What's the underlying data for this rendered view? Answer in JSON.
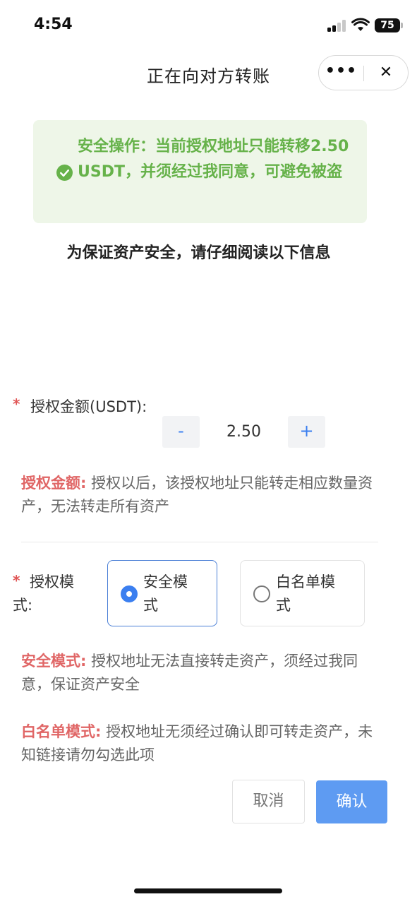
{
  "status_bar": {
    "time": "4:54",
    "battery": "75"
  },
  "header": {
    "title": "正在向对方转账",
    "more_label": "•••",
    "close_label": "✕"
  },
  "notice": {
    "text": "安全操作：当前授权地址只能转移2.50 USDT，并须经过我同意，可避免被盗",
    "icon": "check-circle-icon",
    "color": "#66b24a"
  },
  "subtitle": "为保证资产安全，请仔细阅读以下信息",
  "amount": {
    "required_mark": "*",
    "label": "授权金额(USDT):",
    "minus_label": "-",
    "value": "2.50",
    "plus_label": "+",
    "desc_title": "授权金额:",
    "desc_text": " 授权以后，该授权地址只能转走相应数量资产，无法转走所有资产"
  },
  "mode": {
    "required_mark": "*",
    "label": "授权模式:",
    "options": [
      {
        "label": "安全模式",
        "selected": true
      },
      {
        "label": "白名单模式",
        "selected": false
      }
    ],
    "safe_desc_title": "安全模式:",
    "safe_desc_text": " 授权地址无法直接转走资产，须经过我同意，保证资产安全",
    "white_desc_title": "白名单模式:",
    "white_desc_text": " 授权地址无须经过确认即可转走资产，未知链接请勿勾选此项"
  },
  "actions": {
    "cancel_label": "取消",
    "confirm_label": "确认"
  },
  "colors": {
    "accent": "#3b7ff0",
    "confirm_bg": "#5e9bf2",
    "highlight": "#e06666",
    "required": "#e05555"
  }
}
